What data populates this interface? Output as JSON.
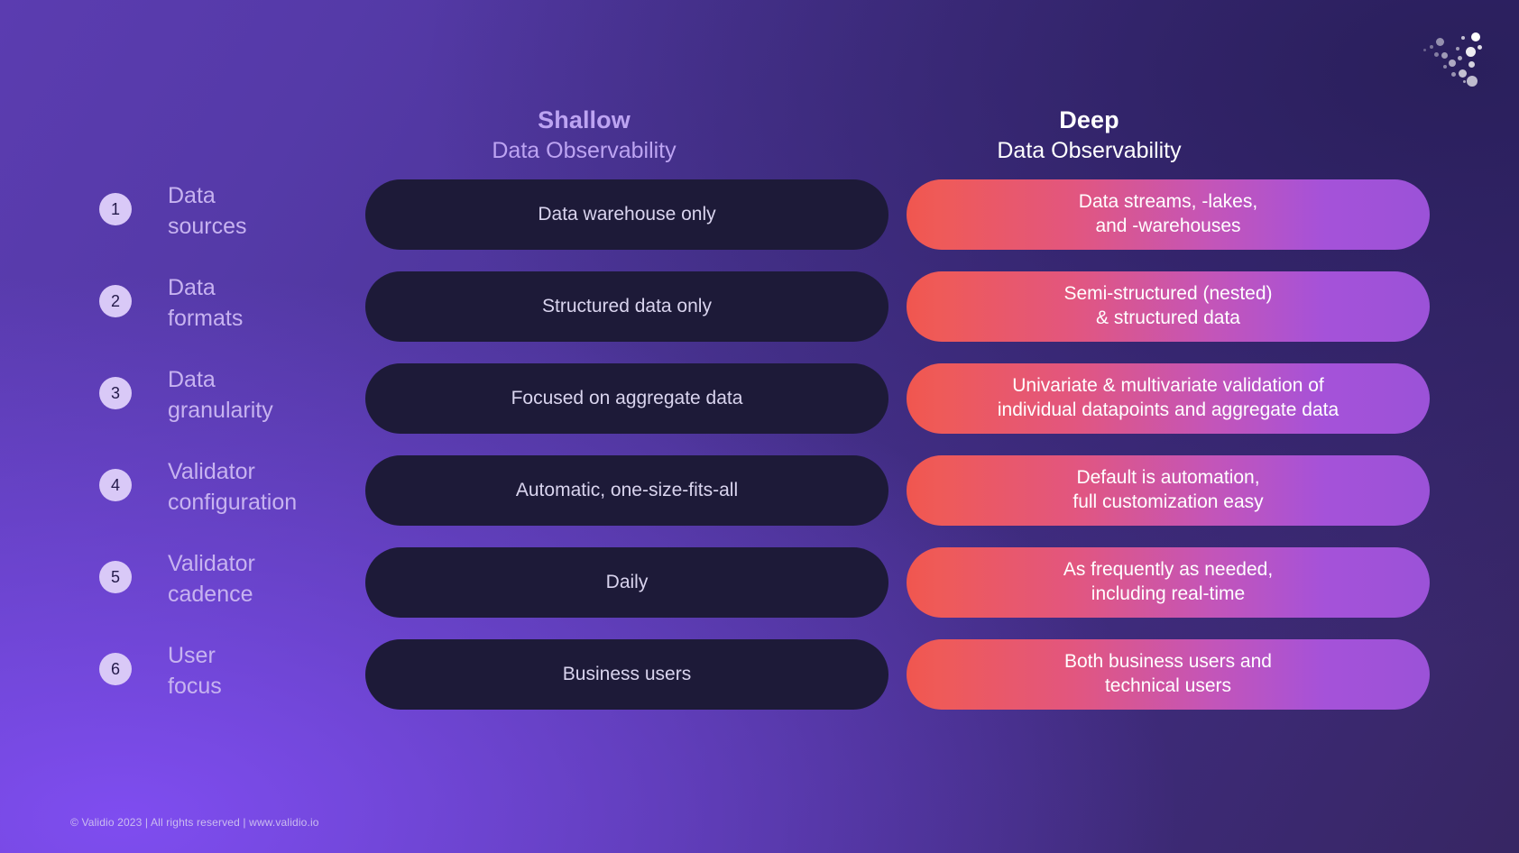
{
  "brand": {
    "logo_icon": "validio-dots-logo"
  },
  "headers": {
    "shallow": {
      "title": "Shallow",
      "subtitle": "Data Observability"
    },
    "deep": {
      "title": "Deep",
      "subtitle": "Data Observability"
    }
  },
  "colors": {
    "background_light": "#7f4df0",
    "background_dark": "#2a1f5c",
    "badge_bg": "#d9c9f7",
    "badge_text": "#241a4a",
    "label_text": "#c7b3f0",
    "shallow_pill_bg": "#1d1a38",
    "deep_gradient_start": "#f0564f",
    "deep_gradient_end": "#9b52d8",
    "shallow_header_text": "#bda4f2",
    "deep_header_text": "#ffffff"
  },
  "rows": [
    {
      "number": "1",
      "label": "Data\nsources",
      "shallow": "Data warehouse only",
      "deep": "Data streams, -lakes,\nand -warehouses"
    },
    {
      "number": "2",
      "label": "Data\nformats",
      "shallow": "Structured data only",
      "deep": "Semi-structured (nested)\n& structured data"
    },
    {
      "number": "3",
      "label": "Data\ngranularity",
      "shallow": "Focused on aggregate data",
      "deep": "Univariate & multivariate validation of\nindividual datapoints and aggregate data"
    },
    {
      "number": "4",
      "label": "Validator\nconfiguration",
      "shallow": "Automatic, one-size-fits-all",
      "deep": "Default is automation,\nfull customization easy"
    },
    {
      "number": "5",
      "label": "Validator\ncadence",
      "shallow": "Daily",
      "deep": "As frequently as needed,\nincluding real-time"
    },
    {
      "number": "6",
      "label": "User\nfocus",
      "shallow": "Business users",
      "deep": "Both business users and\ntechnical users"
    }
  ],
  "footer": {
    "text": "© Validio 2023 | All rights reserved | www.validio.io"
  }
}
